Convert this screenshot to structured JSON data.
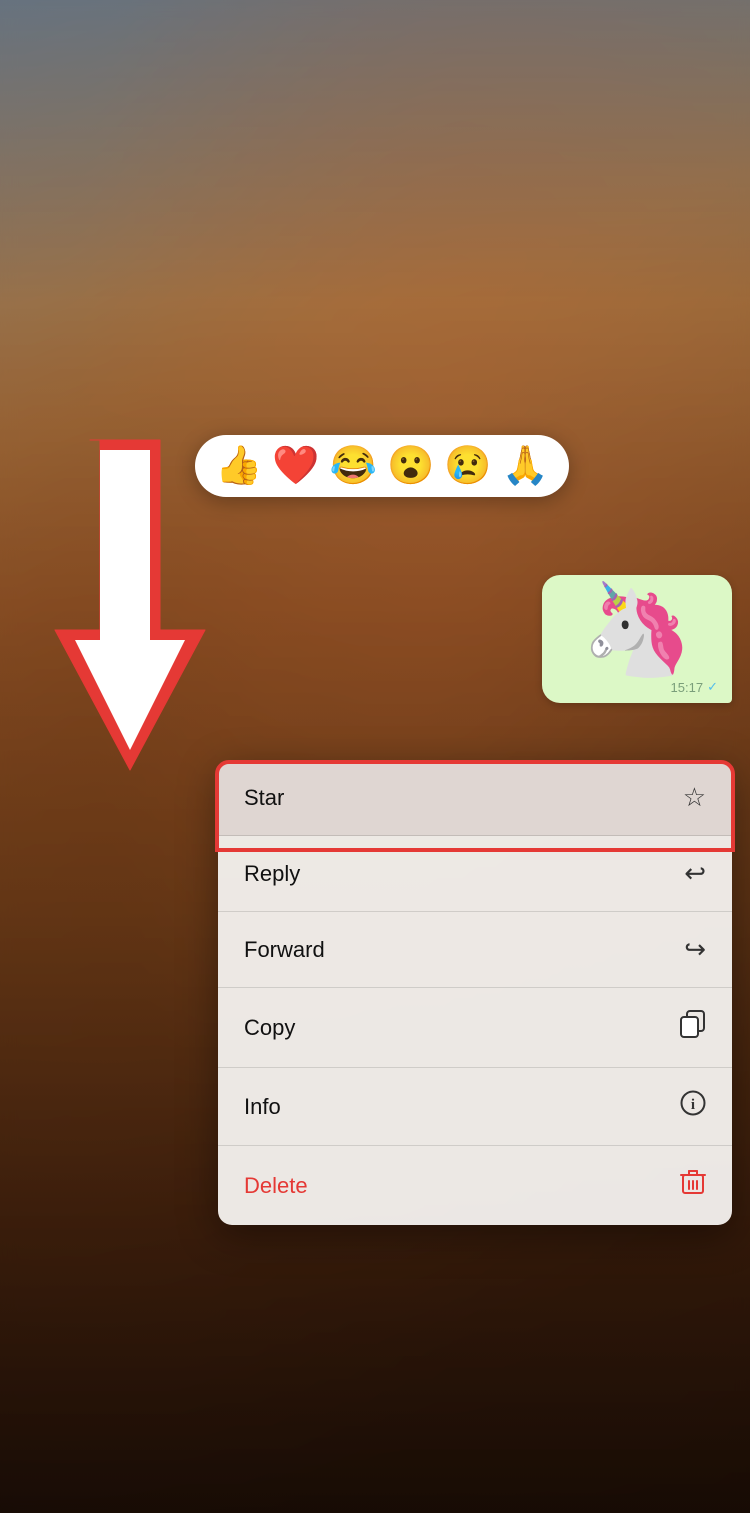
{
  "background": {
    "alt": "Blurred room background"
  },
  "emoji_bar": {
    "emojis": [
      "👍",
      "❤️",
      "😂",
      "😮",
      "😢",
      "🙏"
    ]
  },
  "message": {
    "content": "🦄",
    "time": "15:17",
    "checkmark": "✓"
  },
  "context_menu": {
    "items": [
      {
        "label": "Star",
        "icon": "☆",
        "type": "star",
        "highlighted": true
      },
      {
        "label": "Reply",
        "icon": "↩",
        "type": "reply",
        "highlighted": false
      },
      {
        "label": "Forward",
        "icon": "↪",
        "type": "forward",
        "highlighted": false
      },
      {
        "label": "Copy",
        "icon": "⧉",
        "type": "copy",
        "highlighted": false
      },
      {
        "label": "Info",
        "icon": "ⓘ",
        "type": "info",
        "highlighted": false
      },
      {
        "label": "Delete",
        "icon": "🗑",
        "type": "delete",
        "highlighted": false
      }
    ]
  },
  "arrow": {
    "description": "Red arrow pointing to Star option"
  }
}
